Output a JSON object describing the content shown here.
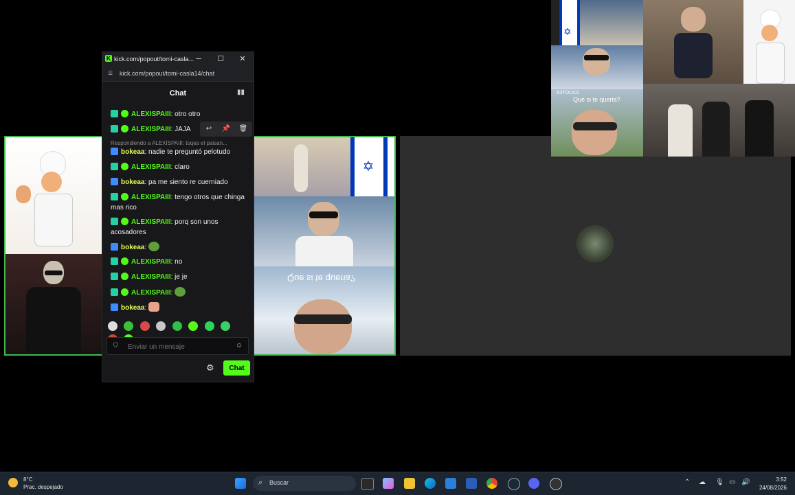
{
  "popout": {
    "title": "kick.com/popout/tomi-casla...",
    "url": "kick.com/popout/tomi-casla14/chat",
    "header": "Chat",
    "reply_hint": "Respondiendo a ALEXISPAIII: toqes el paisan...",
    "messages": [
      {
        "user": "ALEXISPAIII",
        "text": ": otro otro"
      },
      {
        "user": "ALEXISPAIII",
        "text": ": JAJA"
      },
      {
        "user": "bokeaa",
        "text": ": nadie te preguntó pelotudo"
      },
      {
        "user": "ALEXISPAIII",
        "text": ": claro"
      },
      {
        "user": "bokeaa",
        "text": ": pa me siento re cuerniado"
      },
      {
        "user": "ALEXISPAIII",
        "text": ": tengo otros que chinga mas rico"
      },
      {
        "user": "ALEXISPAIII",
        "text": ": porq son unos acosadores"
      },
      {
        "user": "bokeaa",
        "text": ":"
      },
      {
        "user": "ALEXISPAIII",
        "text": ": no"
      },
      {
        "user": "ALEXISPAIII",
        "text": ": je je"
      },
      {
        "user": "ALEXISPAIII",
        "text": ":"
      },
      {
        "user": "bokeaa",
        "text": ":"
      }
    ],
    "input_placeholder": "Enviar un mensaje",
    "send_label": "Chat"
  },
  "overlay": {
    "tile_text": "Que si te queria?",
    "tile_tag": "A3TOUCS"
  },
  "taskbar": {
    "weather_temp": "8°C",
    "weather_desc": "Prac. despejado",
    "search_label": "Buscar",
    "time": "3:52",
    "date": "24/08/2026"
  },
  "colors": {
    "accent": "#53fc18",
    "user_b": "#e6ff4f",
    "panel_bg": "#18181b",
    "tile_border": "#3fb950"
  }
}
